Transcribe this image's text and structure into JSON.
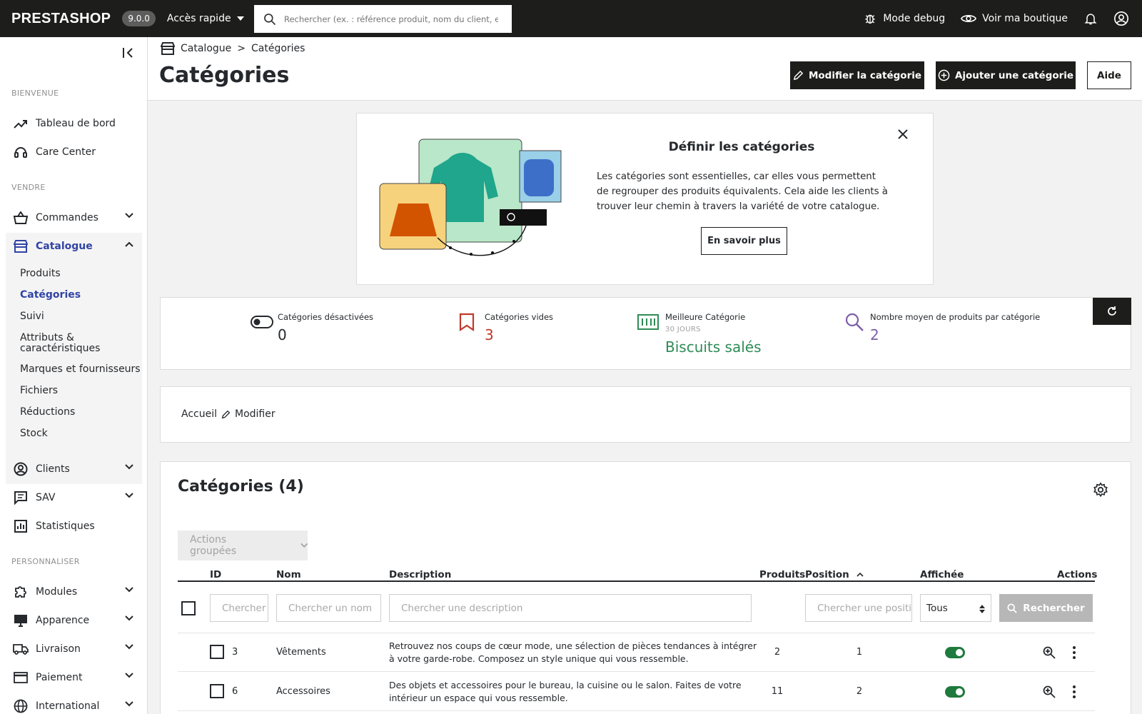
{
  "topbar": {
    "logo": "PRESTASHOP",
    "version": "9.0.0",
    "quick_access": "Accès rapide",
    "search_placeholder": "Rechercher (ex. : référence produit, nom du client, etc.)",
    "debug": "Mode debug",
    "view_shop": "Voir ma boutique"
  },
  "sidebar": {
    "sections": [
      "BIENVENUE",
      "VENDRE",
      "PERSONNALISER"
    ],
    "welcome_items": [
      {
        "label": "Tableau de bord",
        "icon": "trending-up-icon"
      },
      {
        "label": "Care Center",
        "icon": "headset-icon"
      }
    ],
    "sell_items": [
      {
        "label": "Commandes",
        "icon": "basket-icon"
      },
      {
        "label": "Catalogue",
        "icon": "store-icon"
      },
      {
        "label": "Clients",
        "icon": "account-circle-icon"
      },
      {
        "label": "SAV",
        "icon": "chat-icon"
      },
      {
        "label": "Statistiques",
        "icon": "bar-chart-icon"
      }
    ],
    "catalog_sub": [
      "Produits",
      "Catégories",
      "Suivi",
      "Attributs & caractéristiques",
      "Marques et fournisseurs",
      "Fichiers",
      "Réductions",
      "Stock"
    ],
    "customize_items": [
      {
        "label": "Modules",
        "icon": "puzzle-icon"
      },
      {
        "label": "Apparence",
        "icon": "desktop-icon"
      },
      {
        "label": "Livraison",
        "icon": "truck-icon"
      },
      {
        "label": "Paiement",
        "icon": "credit-card-icon"
      },
      {
        "label": "International",
        "icon": "globe-icon"
      }
    ]
  },
  "header": {
    "breadcrumb": [
      "Catalogue",
      "Catégories"
    ],
    "breadcrumb_sep": ">",
    "title": "Catégories",
    "edit_category": "Modifier la catégorie",
    "add_category": "Ajouter une catégorie",
    "help": "Aide"
  },
  "promo": {
    "title": "Définir les catégories",
    "text": "Les catégories sont essentielles, car elles vous permettent de regrouper des produits équivalents. Cela aide les clients à trouver leur chemin à travers la variété de votre catalogue.",
    "button": "En savoir plus"
  },
  "kpis": [
    {
      "label": "Catégories désactivées",
      "value": "0",
      "color": "#25282c",
      "icon": "toggle-off-icon"
    },
    {
      "label": "Catégories vides",
      "value": "3",
      "color": "#c0392b",
      "icon": "bookmark-icon"
    },
    {
      "label": "Meilleure Catégorie",
      "sub": "30 JOURS",
      "value": "Biscuits salés",
      "color": "#2e8b57",
      "icon": "money-icon"
    },
    {
      "label": "Nombre moyen de produits par catégorie",
      "value": "2",
      "color": "#7b5ea7",
      "icon": "search-icon"
    }
  ],
  "category_crumb": {
    "home": "Accueil",
    "edit": "Modifier"
  },
  "grid": {
    "title": "Catégories (4)",
    "bulk": "Actions groupées",
    "columns": [
      "ID",
      "Nom",
      "Description",
      "Produits",
      "Position",
      "Affichée",
      "Actions"
    ],
    "filters": {
      "id_placeholder": "Chercher un ID",
      "name_placeholder": "Chercher un nom",
      "description_placeholder": "Chercher une description",
      "position_placeholder": "Chercher une position",
      "displayed_value": "Tous",
      "search_button": "Rechercher"
    },
    "rows": [
      {
        "id": "3",
        "name": "Vêtements",
        "description": "Retrouvez nos coups de cœur mode, une sélection de pièces tendances à intégrer à votre garde-robe. Composez un style unique qui vous ressemble.",
        "products": "2",
        "position": "1",
        "displayed": true
      },
      {
        "id": "6",
        "name": "Accessoires",
        "description": "Des objets et accessoires pour le bureau, la cuisine ou le salon. Faites de votre intérieur un espace qui vous ressemble.",
        "products": "11",
        "position": "2",
        "displayed": true
      }
    ]
  },
  "colors": {
    "accent": "#3144a5",
    "dark": "#1d1d1b",
    "toggle_on": "#1f7a3e"
  }
}
